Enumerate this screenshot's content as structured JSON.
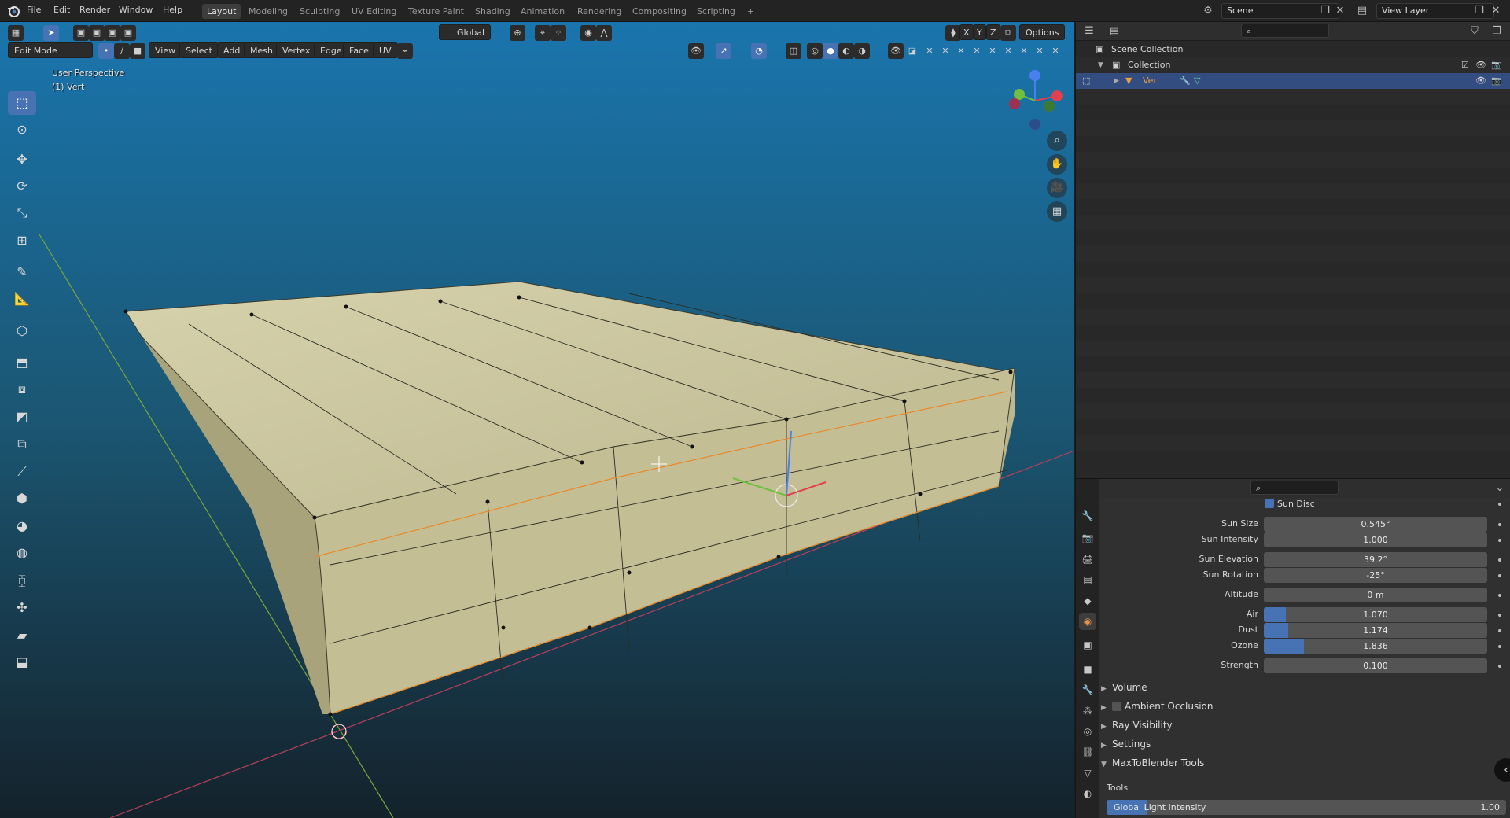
{
  "menu": {
    "items": [
      "File",
      "Edit",
      "Render",
      "Window",
      "Help"
    ],
    "workspaces": [
      "Layout",
      "Modeling",
      "Sculpting",
      "UV Editing",
      "Texture Paint",
      "Shading",
      "Animation",
      "Rendering",
      "Compositing",
      "Scripting"
    ],
    "active_workspace": "Layout",
    "add_tab": "+",
    "scene_name": "Scene",
    "view_layer": "View Layer"
  },
  "viewport": {
    "mode": "Edit Mode",
    "menus": [
      "View",
      "Select",
      "Add",
      "Mesh",
      "Vertex",
      "Edge",
      "Face",
      "UV"
    ],
    "transform_orientation": "Global",
    "options_label": "Options",
    "axis_labels": [
      "X",
      "Y",
      "Z"
    ],
    "overlay_line1": "User Perspective",
    "overlay_line2": "(1) Vert",
    "colors": {
      "bg_top": "#1a6ea3",
      "bg_bottom": "#142a36",
      "mesh": "#c9c49a",
      "accent": "#4772b3"
    }
  },
  "toolbar": {
    "tools": [
      "select-box-icon",
      "cursor-icon",
      "move-icon",
      "rotate-icon",
      "scale-icon",
      "transform-icon",
      "annotate-icon",
      "measure-icon",
      "add-cube-icon",
      "extrude-icon",
      "inset-icon",
      "bevel-icon",
      "loop-cut-icon",
      "knife-icon",
      "poly-build-icon",
      "spin-icon",
      "smooth-icon",
      "edge-slide-icon",
      "shrink-fatten-icon",
      "shear-icon",
      "rip-icon"
    ]
  },
  "outliner": {
    "search_placeholder": "",
    "rows": [
      {
        "label": "Scene Collection"
      },
      {
        "label": "Collection"
      },
      {
        "label": "Vert"
      }
    ]
  },
  "properties": {
    "search_placeholder": "",
    "sun_disc_label": "Sun Disc",
    "fields": [
      {
        "label": "Sun Size",
        "value": "0.545°",
        "fill": 0
      },
      {
        "label": "Sun Intensity",
        "value": "1.000",
        "fill": 0
      },
      {
        "label": "Sun Elevation",
        "value": "39.2°",
        "fill": 0
      },
      {
        "label": "Sun Rotation",
        "value": "-25°",
        "fill": 0
      },
      {
        "label": "Altitude",
        "value": "0 m",
        "fill": 0
      },
      {
        "label": "Air",
        "value": "1.070",
        "fill": 0.1
      },
      {
        "label": "Dust",
        "value": "1.174",
        "fill": 0.11
      },
      {
        "label": "Ozone",
        "value": "1.836",
        "fill": 0.18
      },
      {
        "label": "Strength",
        "value": "0.100",
        "fill": 0
      }
    ],
    "panels": [
      "Volume",
      "Ambient Occlusion",
      "Ray Visibility",
      "Settings",
      "MaxToBlender Tools"
    ],
    "tools_label": "Tools",
    "global_light": {
      "label": "Global Light Intensity",
      "value": "1.00",
      "fill": 0.1
    }
  }
}
